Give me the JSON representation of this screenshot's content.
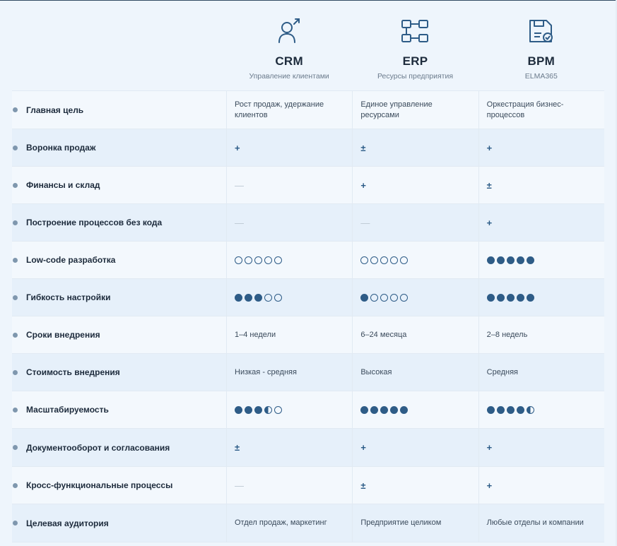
{
  "columns": [
    {
      "title": "CRM",
      "subtitle": "Управление клиентами",
      "icon": "user-icon"
    },
    {
      "title": "ERP",
      "subtitle": "Ресурсы предприятия",
      "icon": "structure-icon"
    },
    {
      "title": "BPM",
      "subtitle": "ELMA365",
      "icon": "document-check-icon"
    }
  ],
  "rows": [
    {
      "label": "Главная цель",
      "cells": [
        {
          "kind": "text",
          "value": "Рост продаж, удержание клиентов"
        },
        {
          "kind": "text",
          "value": "Единое управление ресурсами"
        },
        {
          "kind": "text",
          "value": "Оркестрация бизнес-процессов"
        }
      ]
    },
    {
      "label": "Воронка продаж",
      "cells": [
        {
          "kind": "symbol",
          "value": "+"
        },
        {
          "kind": "symbol",
          "value": "±"
        },
        {
          "kind": "symbol",
          "value": "+"
        }
      ]
    },
    {
      "label": "Финансы и склад",
      "cells": [
        {
          "kind": "symbol",
          "value": "—"
        },
        {
          "kind": "symbol",
          "value": "+"
        },
        {
          "kind": "symbol",
          "value": "±"
        }
      ]
    },
    {
      "label": "Построение процессов без кода",
      "cells": [
        {
          "kind": "symbol",
          "value": "—"
        },
        {
          "kind": "symbol",
          "value": "—"
        },
        {
          "kind": "symbol",
          "value": "+"
        }
      ]
    },
    {
      "label": "Low-code разработка",
      "cells": [
        {
          "kind": "rating",
          "value": 0
        },
        {
          "kind": "rating",
          "value": 0
        },
        {
          "kind": "rating",
          "value": 5
        }
      ]
    },
    {
      "label": "Гибкость настройки",
      "cells": [
        {
          "kind": "rating",
          "value": 3
        },
        {
          "kind": "rating",
          "value": 1
        },
        {
          "kind": "rating",
          "value": 5
        }
      ]
    },
    {
      "label": "Сроки внедрения",
      "cells": [
        {
          "kind": "text",
          "value": "1–4 недели"
        },
        {
          "kind": "text",
          "value": "6–24 месяца"
        },
        {
          "kind": "text",
          "value": "2–8 недель"
        }
      ]
    },
    {
      "label": "Стоимость внедрения",
      "cells": [
        {
          "kind": "text",
          "value": "Низкая - средняя"
        },
        {
          "kind": "text",
          "value": "Высокая"
        },
        {
          "kind": "text",
          "value": "Средняя"
        }
      ]
    },
    {
      "label": "Масштабируемость",
      "cells": [
        {
          "kind": "rating",
          "value": 3.5
        },
        {
          "kind": "rating",
          "value": 5
        },
        {
          "kind": "rating",
          "value": 4.5
        }
      ]
    },
    {
      "label": "Документооборот и согласования",
      "cells": [
        {
          "kind": "symbol",
          "value": "±"
        },
        {
          "kind": "symbol",
          "value": "+"
        },
        {
          "kind": "symbol",
          "value": "+"
        }
      ]
    },
    {
      "label": "Кросс-функциональные процессы",
      "cells": [
        {
          "kind": "symbol",
          "value": "—"
        },
        {
          "kind": "symbol",
          "value": "±"
        },
        {
          "kind": "symbol",
          "value": "+"
        }
      ]
    },
    {
      "label": "Целевая аудитория",
      "cells": [
        {
          "kind": "text",
          "value": "Отдел продаж, маркетинг"
        },
        {
          "kind": "text",
          "value": "Предприятие целиком"
        },
        {
          "kind": "text",
          "value": "Любые отделы и компании"
        }
      ]
    }
  ],
  "colors": {
    "accent": "#2e5c87",
    "bullet": "#7f97ae",
    "row_alt": "#e6f0fa",
    "row_base": "#f3f8fd"
  }
}
